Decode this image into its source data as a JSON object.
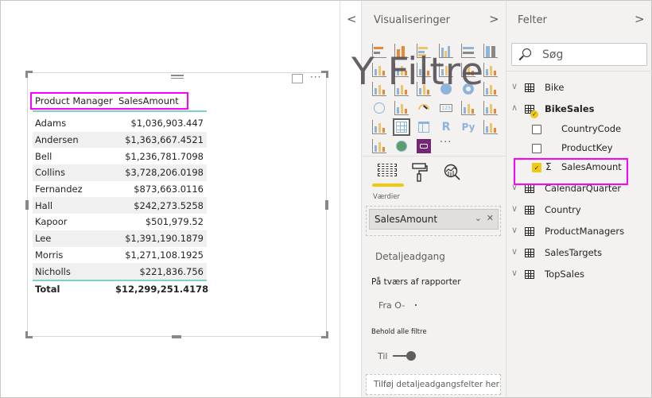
{
  "canvas": {
    "visual": {
      "more_options_label": "···",
      "table": {
        "columns": [
          "Product Manager",
          "SalesAmount"
        ],
        "rows": [
          {
            "name": "Adams",
            "amount": "$1,036,903.447"
          },
          {
            "name": "Andersen",
            "amount": "$1,363,667.4521"
          },
          {
            "name": "Bell",
            "amount": "$1,236,781.7098"
          },
          {
            "name": "Collins",
            "amount": "$3,728,206.0198"
          },
          {
            "name": "Fernandez",
            "amount": "$873,663.0116"
          },
          {
            "name": "Hall",
            "amount": "$242,273.5258"
          },
          {
            "name": "Kapoor",
            "amount": "$501,979.52"
          },
          {
            "name": "Lee",
            "amount": "$1,391,190.1879"
          },
          {
            "name": "Morris",
            "amount": "$1,271,108.1925"
          },
          {
            "name": "Nicholls",
            "amount": "$221,836.756"
          }
        ],
        "total": {
          "label": "Total",
          "amount": "$12,299,251.4178"
        }
      }
    }
  },
  "collapse_strip": {
    "chevron": "<"
  },
  "visualizations": {
    "title": "Visualiseringer",
    "next_chevron": ">",
    "icons": [
      "stacked-bar-chart",
      "stacked-column-chart",
      "clustered-bar-chart",
      "clustered-column-chart",
      "100-stacked-bar-chart",
      "100-stacked-column-chart",
      "line-chart",
      "area-chart",
      "stacked-area-chart",
      "line-clustered-column-chart",
      "line-stacked-column-chart",
      "ribbon-chart",
      "waterfall-chart",
      "funnel-chart",
      "scatter-chart",
      "pie-chart",
      "donut-chart",
      "treemap",
      "map",
      "filled-map",
      "gauge",
      "card",
      "multi-row-card",
      "kpi",
      "slicer",
      "table",
      "matrix",
      "r-visual",
      "python-visual",
      "key-influencers",
      "decomposition-tree",
      "arcgis-map",
      "custom-visual",
      "more-visuals"
    ],
    "icon_text": {
      "r": "R",
      "py": "Py",
      "more": "···"
    },
    "watermark": "Y Filtre",
    "tabs": [
      "fields",
      "format",
      "analytics"
    ],
    "values_label": "Værdier",
    "values_field": "SalesAmount",
    "drillthrough": {
      "title": "Detaljeadgang",
      "cross_report": "På tværs af rapporter",
      "cross_report_state": "Fra O-",
      "keep_filters": "Behold alle filtre",
      "keep_filters_state": "Til",
      "keep_filters_on": true,
      "drop_placeholder": "Tilføj detaljeadgangsfelter her"
    }
  },
  "fields": {
    "title": "Felter",
    "next_chevron": ">",
    "search_placeholder": "Søg",
    "tables": [
      {
        "name": "Bike",
        "expanded": false
      },
      {
        "name": "BikeSales",
        "expanded": true,
        "has_selection": true,
        "fields": [
          {
            "name": "CountryCode",
            "checked": false,
            "sigma": false
          },
          {
            "name": "ProductKey",
            "checked": false,
            "sigma": false
          },
          {
            "name": "SalesAmount",
            "checked": true,
            "sigma": true
          }
        ]
      },
      {
        "name": "CalendarQuarter",
        "expanded": false
      },
      {
        "name": "Country",
        "expanded": false
      },
      {
        "name": "ProductManagers",
        "expanded": false
      },
      {
        "name": "SalesTargets",
        "expanded": false
      },
      {
        "name": "TopSales",
        "expanded": false
      }
    ],
    "glyphs": {
      "expand": "∨",
      "collapse": "∧",
      "check": "✓",
      "sigma": "Σ"
    }
  },
  "colors": {
    "highlight": "#ff00ff",
    "accent_yellow": "#f2c811",
    "table_rule": "#7fd0c8",
    "pane_bg": "#f3f2f1",
    "custom_visual": "#742774"
  }
}
